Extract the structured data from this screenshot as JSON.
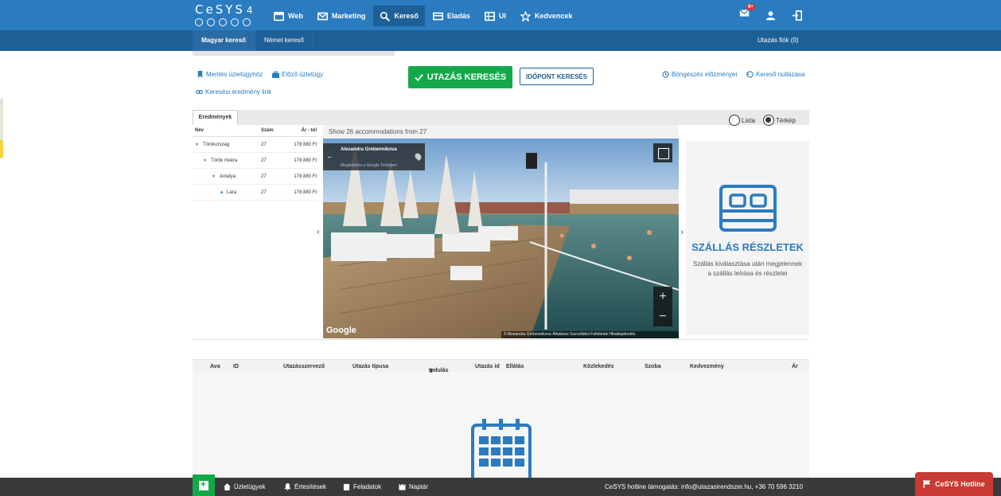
{
  "app": {
    "logo_text": "CeSYS",
    "logo_version": "4"
  },
  "nav": {
    "items": [
      {
        "label": "Web",
        "icon": "browser-icon"
      },
      {
        "label": "Marketing",
        "icon": "mail-icon"
      },
      {
        "label": "Kereső",
        "icon": "search-icon",
        "active": true
      },
      {
        "label": "Eladás",
        "icon": "card-icon"
      },
      {
        "label": "UI",
        "icon": "grid-icon"
      },
      {
        "label": "Kedvencek",
        "icon": "star-icon"
      }
    ],
    "mail_badge": "9+"
  },
  "subnav": {
    "tabs": [
      {
        "label": "Magyar kereső",
        "active": true
      },
      {
        "label": "Német kereső"
      }
    ],
    "right_label": "Utazás fiók (0)"
  },
  "actions": {
    "save_deal": "Mentés üzletügyhöz",
    "prev_deal": "Előző üzletügy",
    "result_link": "Keresési eredmény link",
    "search_button": "UTAZÁS KERESÉS",
    "time_search_button": "IDŐPONT KERESÉS",
    "history": "Böngészés előzményei",
    "reset": "Kereső nullázása"
  },
  "results": {
    "tab_label": "Eredmények",
    "view_options": {
      "list": "Lista",
      "map": "Térkép",
      "selected": "map"
    },
    "tree_headers": {
      "name": "Név",
      "count": "Szám",
      "price": "Ár - tól"
    },
    "tree_rows": [
      {
        "name": "Törökország",
        "count": "27",
        "price": "178 880 Ft",
        "level": 0
      },
      {
        "name": "Török riviéra",
        "count": "27",
        "price": "178 880 Ft",
        "level": 1
      },
      {
        "name": "Antalya",
        "count": "27",
        "price": "178 880 Ft",
        "level": 2
      },
      {
        "name": "Lara",
        "count": "27",
        "price": "178 880 Ft",
        "level": 3
      }
    ],
    "show_info": "Show 26 accommodations  from 27"
  },
  "streetview": {
    "author": "Alexandra Grebennikova",
    "subtitle": "Megtekintés a Google Térképen",
    "google_logo": "Google",
    "attribution": "© Alexandra Grebennikova    Általános Szerződési Feltételek    Hibabejelentés"
  },
  "detail": {
    "title": "SZÁLLÁS RÉSZLETEK",
    "description": "Szállás kiválasztása után megjelennek a szállás leírása és részletei",
    "icon": "bed-icon"
  },
  "table": {
    "columns": [
      "Ava",
      "ID",
      "Utazásszervező",
      "Utazás típusa",
      "Indulás",
      "Utazás id",
      "Ellátás",
      "Közlekedés",
      "Szoba",
      "Kedvezmény",
      "Ár"
    ]
  },
  "footer": {
    "items": [
      {
        "label": "Üzletügyek",
        "icon": "home-icon"
      },
      {
        "label": "Értesítések",
        "icon": "bell-icon"
      },
      {
        "label": "Feladatok",
        "icon": "clipboard-icon"
      },
      {
        "label": "Naptár",
        "icon": "calendar-icon"
      }
    ],
    "hotline_text": "CeSYS hotline támogatás: info@utazasirendszer.hu, +36 70 596 3210",
    "hotline_button": "CeSYS Hotline"
  },
  "colors": {
    "brand_blue": "#2b7bc0",
    "dark_blue": "#1e5f96",
    "green": "#13a94a",
    "hotline_red": "#c83a32"
  }
}
